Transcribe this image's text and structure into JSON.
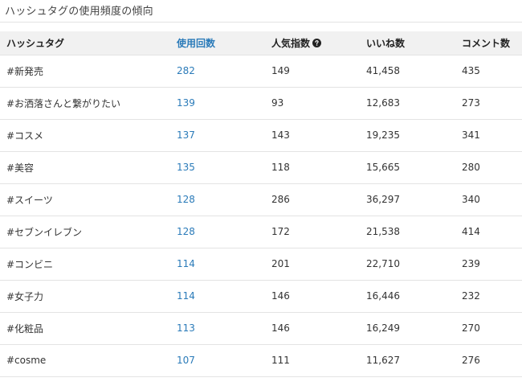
{
  "page_title": "ハッシュタグの使用頻度の傾向",
  "colors": {
    "header_bg": "#f1f1f1",
    "link_blue": "#2b7bb9",
    "row_border": "#e3e3e3",
    "text": "#333333"
  },
  "table": {
    "columns": {
      "hashtag": "ハッシュタグ",
      "usage_count": "使用回数",
      "popularity_index": "人気指数",
      "likes": "いいね数",
      "comments": "コメント数"
    },
    "popularity_help_icon": "help-circle-icon",
    "rows": [
      {
        "hashtag": "#新発売",
        "usage_count": "282",
        "popularity_index": "149",
        "likes": "41,458",
        "comments": "435"
      },
      {
        "hashtag": "#お洒落さんと繋がりたい",
        "usage_count": "139",
        "popularity_index": "93",
        "likes": "12,683",
        "comments": "273"
      },
      {
        "hashtag": "#コスメ",
        "usage_count": "137",
        "popularity_index": "143",
        "likes": "19,235",
        "comments": "341"
      },
      {
        "hashtag": "#美容",
        "usage_count": "135",
        "popularity_index": "118",
        "likes": "15,665",
        "comments": "280"
      },
      {
        "hashtag": "#スイーツ",
        "usage_count": "128",
        "popularity_index": "286",
        "likes": "36,297",
        "comments": "340"
      },
      {
        "hashtag": "#セブンイレブン",
        "usage_count": "128",
        "popularity_index": "172",
        "likes": "21,538",
        "comments": "414"
      },
      {
        "hashtag": "#コンビニ",
        "usage_count": "114",
        "popularity_index": "201",
        "likes": "22,710",
        "comments": "239"
      },
      {
        "hashtag": "#女子力",
        "usage_count": "114",
        "popularity_index": "146",
        "likes": "16,446",
        "comments": "232"
      },
      {
        "hashtag": "#化粧品",
        "usage_count": "113",
        "popularity_index": "146",
        "likes": "16,249",
        "comments": "270"
      },
      {
        "hashtag": "#cosme",
        "usage_count": "107",
        "popularity_index": "111",
        "likes": "11,627",
        "comments": "276"
      }
    ]
  }
}
